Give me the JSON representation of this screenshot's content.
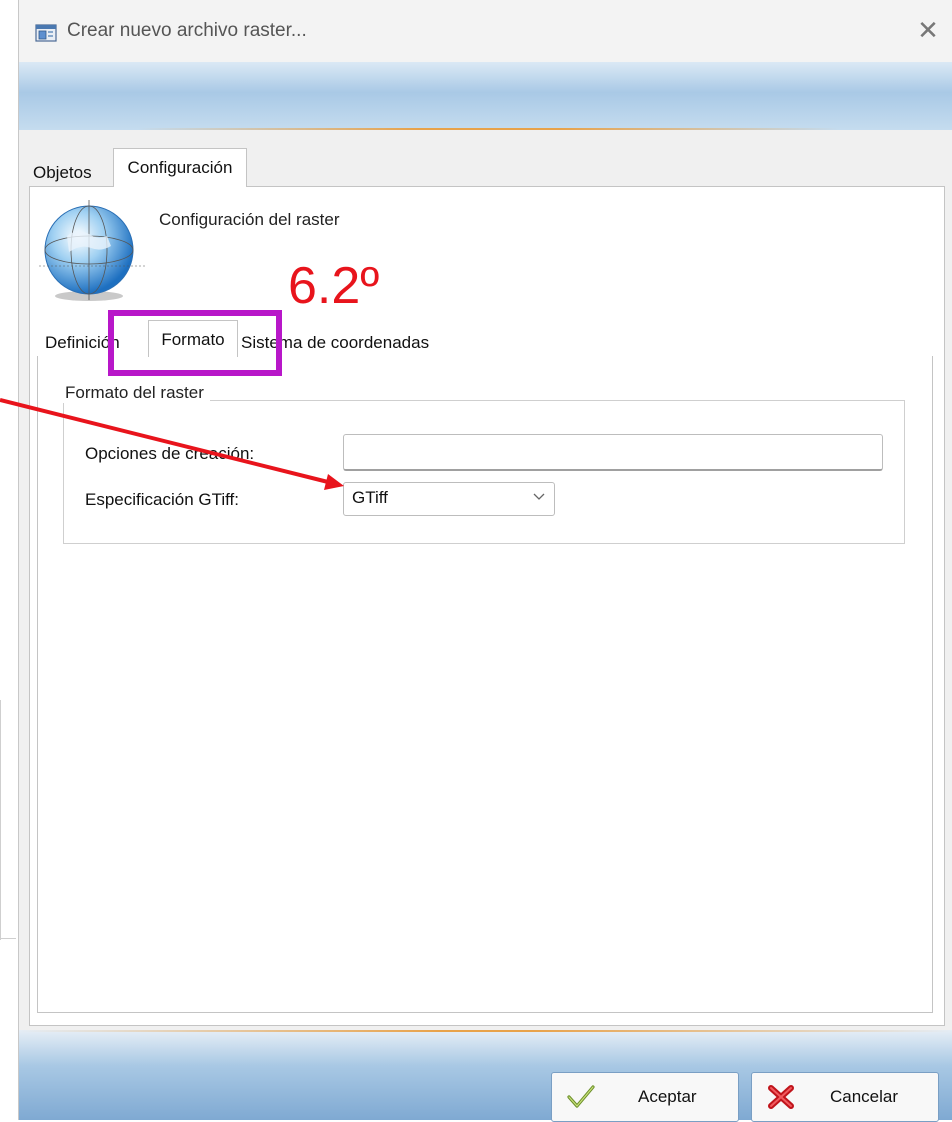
{
  "window": {
    "title": "Crear nuevo archivo raster...",
    "close_glyph": "✕"
  },
  "outer_tabs": [
    {
      "label": "Objetos",
      "active": false
    },
    {
      "label": "Configuración",
      "active": true
    }
  ],
  "header": {
    "heading": "Configuración del raster",
    "icon": "globe-icon"
  },
  "inner_tabs": [
    {
      "label": "Definición",
      "active": false
    },
    {
      "label": "Formato",
      "active": true
    },
    {
      "label": "Sistema de coordenadas",
      "active": false
    }
  ],
  "format_group": {
    "legend": "Formato del raster",
    "creation_options": {
      "label": "Opciones de creación:",
      "value": ""
    },
    "gtiff_spec": {
      "label": "Especificación GTiff:",
      "selected": "GTiff"
    }
  },
  "buttons": {
    "ok_label": "Aceptar",
    "cancel_label": "Cancelar"
  },
  "annotation": {
    "step_label": "6.2º",
    "box_color": "#b817c9",
    "arrow_color": "#e8141c"
  }
}
